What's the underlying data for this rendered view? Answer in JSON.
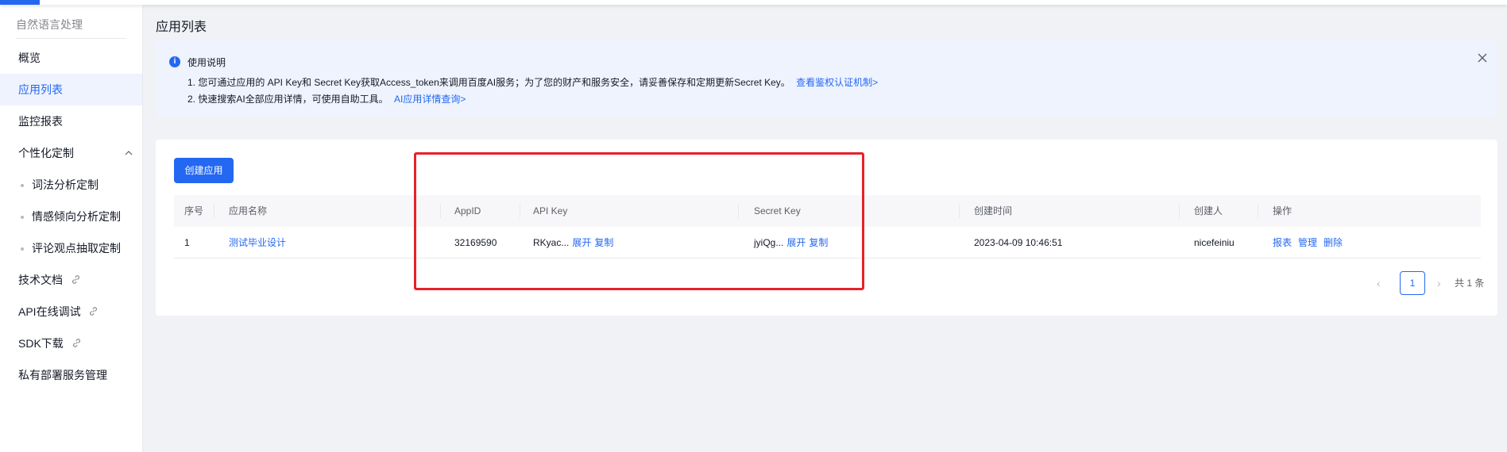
{
  "sidebar": {
    "product_title": "自然语言处理",
    "items": [
      {
        "label": "概览"
      },
      {
        "label": "应用列表"
      },
      {
        "label": "监控报表"
      },
      {
        "label": "个性化定制"
      },
      {
        "label": "词法分析定制"
      },
      {
        "label": "情感倾向分析定制"
      },
      {
        "label": "评论观点抽取定制"
      },
      {
        "label": "技术文档"
      },
      {
        "label": "API在线调试"
      },
      {
        "label": "SDK下载"
      },
      {
        "label": "私有部署服务管理"
      }
    ]
  },
  "page": {
    "title": "应用列表"
  },
  "notice": {
    "title": "使用说明",
    "line1": "1. 您可通过应用的 API Key和 Secret Key获取Access_token来调用百度AI服务；为了您的财产和服务安全，请妥善保存和定期更新Secret Key。",
    "line1_link": "查看鉴权认证机制>",
    "line2": "2. 快速搜索AI全部应用详情，可使用自助工具。",
    "line2_link": "AI应用详情查询>"
  },
  "toolbar": {
    "create_label": "创建应用"
  },
  "table": {
    "headers": [
      "序号",
      "应用名称",
      "AppID",
      "API Key",
      "Secret Key",
      "创建时间",
      "创建人",
      "操作"
    ],
    "rows": [
      {
        "index": "1",
        "name": "测试毕业设计",
        "appid": "32169590",
        "api_key": "RKyac...",
        "secret_key": "jyiQg...",
        "expand": "展开",
        "copy": "复制",
        "created": "2023-04-09 10:46:51",
        "creator": "nicefeiniu",
        "ops": [
          "报表",
          "管理",
          "删除"
        ]
      }
    ]
  },
  "pagination": {
    "prev": "‹",
    "current": "1",
    "next": "›",
    "total": "共 1 条"
  },
  "colors": {
    "primary": "#2468f2",
    "highlight_box": "#e8202a",
    "notice_bg": "#eef3fe"
  }
}
